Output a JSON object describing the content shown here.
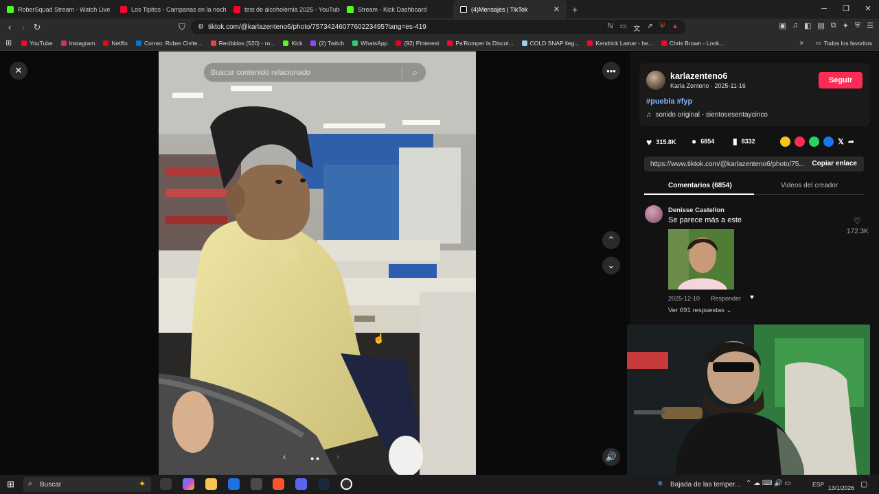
{
  "tabs": [
    {
      "title": "RoberSquad Stream - Watch Live",
      "color": "#53fc18"
    },
    {
      "title": "Los Tipitos - Campanas en la noche",
      "color": "#ff0033"
    },
    {
      "title": "test de alcoholemia 2025 - YouTube",
      "color": "#ff0033"
    },
    {
      "title": "Stream - Kick Dashboard",
      "color": "#53fc18"
    },
    {
      "title": "(4)Mensajes | TikTok",
      "color": "#ffffff"
    }
  ],
  "address": {
    "url": "tiktok.com/@karlazenteno6/photo/7573424607760223495?lang=es-419"
  },
  "bookmarks": [
    {
      "label": "YouTube",
      "color": "#ff0033"
    },
    {
      "label": "Instagram",
      "color": "#d62976"
    },
    {
      "label": "Netflix",
      "color": "#e50914"
    },
    {
      "label": "Correo: Rober Civite...",
      "color": "#0078d4"
    },
    {
      "label": "Recibidos (520) - ro...",
      "color": "#ea4335"
    },
    {
      "label": "Kick",
      "color": "#53fc18"
    },
    {
      "label": "(2) Twitch",
      "color": "#9146ff"
    },
    {
      "label": "WhatsApp",
      "color": "#25d366"
    },
    {
      "label": "(92) Pinterest",
      "color": "#e60023"
    },
    {
      "label": "Pa'Romper la Discot...",
      "color": "#ff0033"
    },
    {
      "label": "COLD SNAP lleg...",
      "color": "#9ad0f5"
    },
    {
      "label": "Kendrick Lamar - he...",
      "color": "#ff0033"
    },
    {
      "label": "Chris Brown - Look...",
      "color": "#ff0033"
    }
  ],
  "bookmarks_all": "Todos los favoritos",
  "viewer": {
    "search_placeholder": "Buscar contenido relacionado"
  },
  "creator": {
    "username": "karlazenteno6",
    "display": "Karla Zenteno · 2025-11-16",
    "tags": "#puebla #fyp",
    "sound": "sonido original - sientosesentaycinco",
    "follow": "Seguir"
  },
  "stats": {
    "likes": "315.8K",
    "comments": "6854",
    "saves": "8332"
  },
  "link": {
    "url": "https://www.tiktok.com/@karlazenteno6/photo/75...",
    "copy": "Copiar enlace"
  },
  "panel_tabs": {
    "comments": "Comentarios (6854)",
    "videos": "Videos del creador"
  },
  "comment": {
    "author": "Denisse Castellon",
    "text": "Se parece más a este",
    "likes": "172.3K",
    "date": "2025-12-10",
    "reply": "Responder",
    "view_replies": "Ver 691 respuestas"
  },
  "taskbar": {
    "search": "Buscar",
    "weather": "Bajada de las temper...",
    "lang": "ESP",
    "date": "13/1/2026"
  }
}
